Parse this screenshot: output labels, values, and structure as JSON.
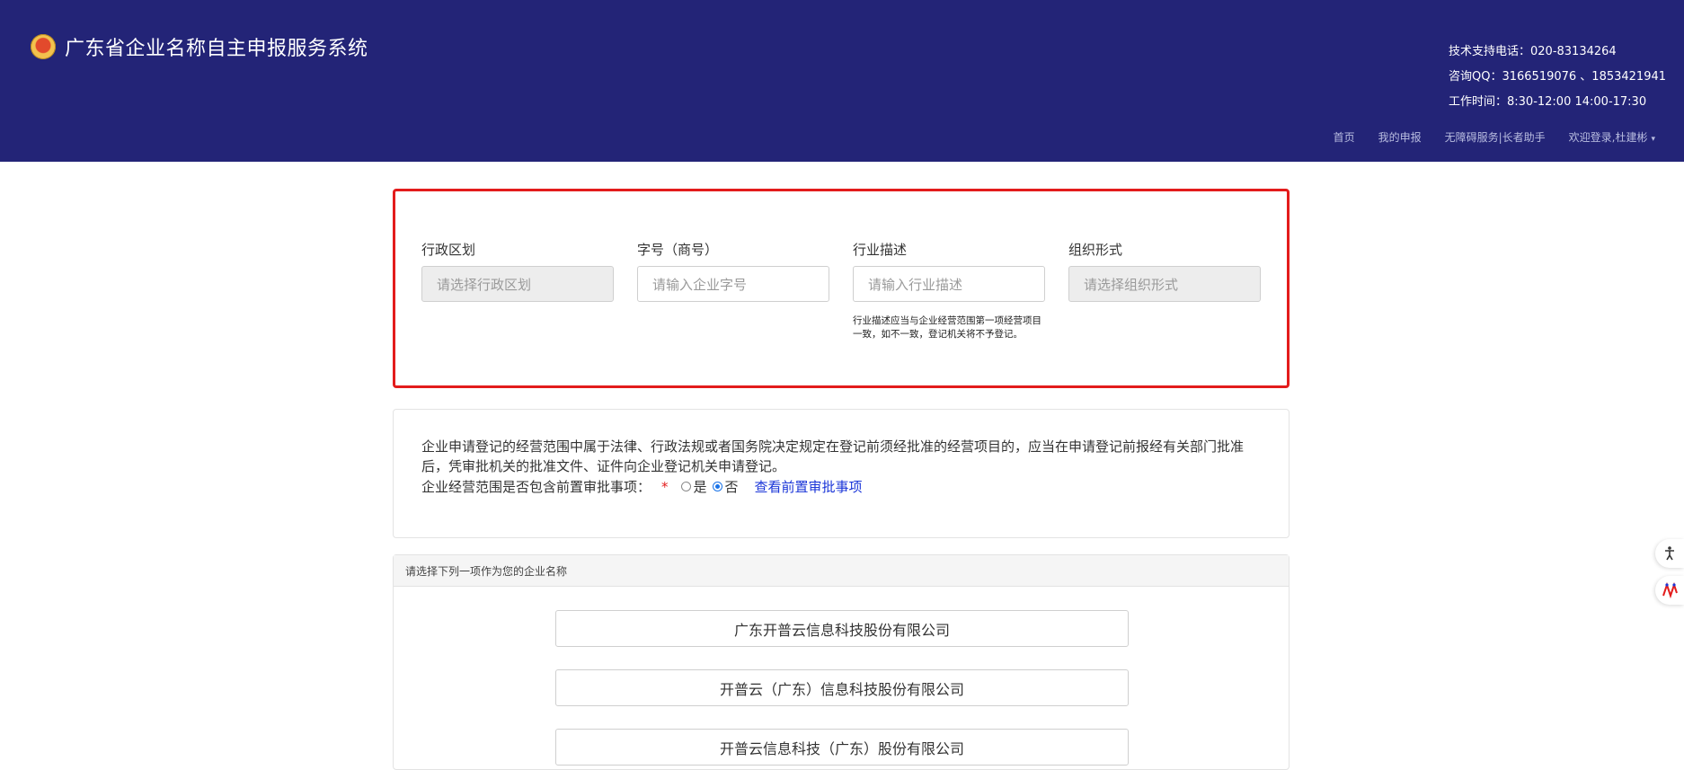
{
  "header": {
    "title": "广东省企业名称自主申报服务系统",
    "contact": {
      "phone": "技术支持电话：020-83134264",
      "qq": "咨询QQ：3166519076  、1853421941",
      "hours": "工作时间：8:30-12:00 14:00-17:30"
    },
    "nav": [
      "首页",
      "我的申报",
      "无障碍服务|长者助手",
      "欢迎登录,杜建彬"
    ]
  },
  "form": {
    "fields": [
      {
        "label": "行政区划",
        "placeholder": "请选择行政区划"
      },
      {
        "label": "字号（商号）",
        "placeholder": "请输入企业字号"
      },
      {
        "label": "行业描述",
        "placeholder": "请输入行业描述"
      },
      {
        "label": "组织形式",
        "placeholder": "请选择组织形式"
      }
    ],
    "industry_hint": "行业描述应当与企业经营范围第一项经营项目一致，如不一致，登记机关将不予登记。"
  },
  "notice": {
    "text": "企业申请登记的经营范围中属于法律、行政法规或者国务院决定规定在登记前须经批准的经营项目的，应当在申请登记前报经有关部门批准后，凭审批机关的批准文件、证件向企业登记机关申请登记。",
    "question": "企业经营范围是否包含前置审批事项：",
    "required_mark": "*",
    "option_yes": "是",
    "option_no": "否",
    "selected": "否",
    "link": "查看前置审批事项"
  },
  "names": {
    "heading": "请选择下列一项作为您的企业名称",
    "options": [
      "广东开普云信息科技股份有限公司",
      "开普云（广东）信息科技股份有限公司",
      "开普云信息科技（广东）股份有限公司"
    ]
  },
  "side": {
    "accessibility_icon": "accessibility-icon",
    "elder_icon": "elder-assist-icon"
  }
}
